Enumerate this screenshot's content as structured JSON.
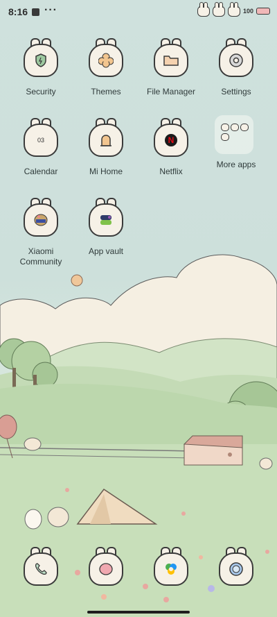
{
  "status_bar": {
    "time": "8:16",
    "more": "···",
    "battery": "100"
  },
  "home": {
    "apps": [
      {
        "label": "Security",
        "icon": "shield-icon"
      },
      {
        "label": "Themes",
        "icon": "flower-icon"
      },
      {
        "label": "File Manager",
        "icon": "folder-icon"
      },
      {
        "label": "Settings",
        "icon": "gear-icon"
      },
      {
        "label": "Calendar",
        "icon": "calendar-icon",
        "badge": "03"
      },
      {
        "label": "Mi Home",
        "icon": "home-icon"
      },
      {
        "label": "Netflix",
        "icon": "netflix-icon"
      },
      {
        "label": "More apps",
        "icon": "folder-apps-icon"
      },
      {
        "label": "Xiaomi\nCommunity",
        "icon": "community-icon"
      },
      {
        "label": "App vault",
        "icon": "app-vault-icon"
      }
    ]
  },
  "dock": {
    "apps": [
      {
        "icon": "phone-icon"
      },
      {
        "icon": "messages-icon"
      },
      {
        "icon": "browser-icon"
      },
      {
        "icon": "camera-icon"
      }
    ]
  },
  "colors": {
    "sky": "#cfe1dd",
    "cloud": "#f5efe2",
    "hill": "#bdd7b4",
    "grass": "#c3dcb4",
    "outline": "#3a3a3a"
  }
}
